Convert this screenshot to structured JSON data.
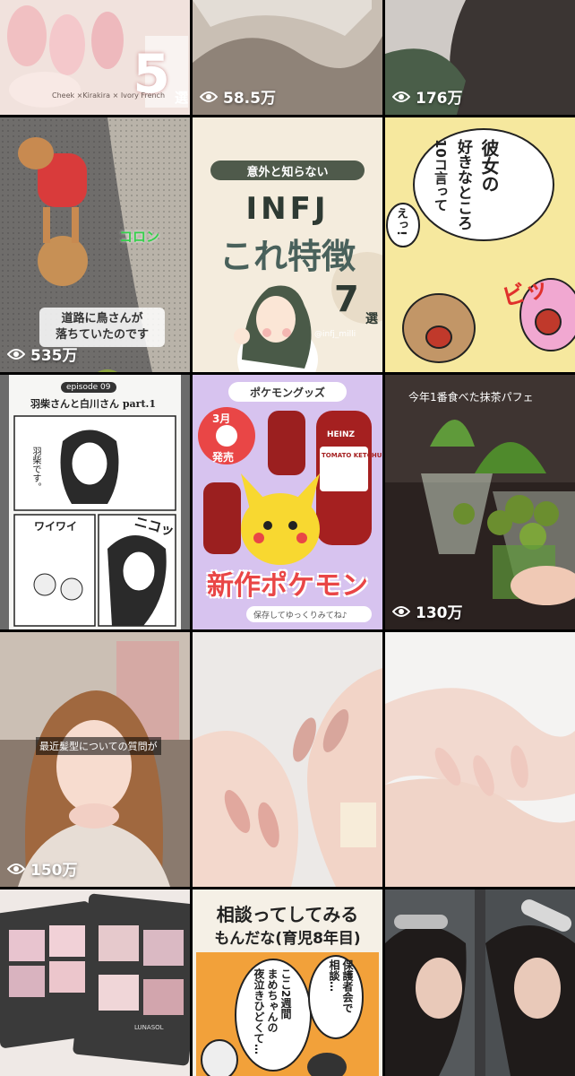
{
  "tiles": [
    {
      "views": "",
      "big_num": "5",
      "big_suffix": "選",
      "small_caption": "Cheek ×Kirakira × Ivory French"
    },
    {
      "views": "58.5万"
    },
    {
      "views": "176万"
    },
    {
      "views": "535万",
      "bubble": "道路に鳥さんが\n落ちていたのです",
      "tag": "コロン"
    },
    {
      "views": "",
      "banner": "意外と知らない",
      "line1": "INFJ",
      "line2": "これ特徴",
      "num": "7",
      "suffix": "選",
      "handle": "@infj_milli"
    },
    {
      "views": "",
      "speech_lines": [
        "彼女の",
        "好きなところ",
        "10コ言って"
      ],
      "small_bubble": "えっ!",
      "sfx": "ビッ"
    },
    {
      "views": "",
      "episode": "episode 09",
      "title": "羽柴さんと白川さん part.1",
      "bubble1": "羽柴です。",
      "bubble2": "ワイワイ",
      "sfx": "ニコッ"
    },
    {
      "views": "",
      "header": "ポケモングッズ",
      "date_month": "3月",
      "date_label": "発売",
      "brand": "HEINZ",
      "product": "TOMATO KETCHUP",
      "headline": "新作ポケモン",
      "save_bar": "保存してゆっくりみてね♪"
    },
    {
      "views": "130万",
      "overlay_text": "今年1番食べた抹茶パフェ"
    },
    {
      "views": "150万",
      "caption": "最近髪型についての質問が"
    },
    {
      "views": ""
    },
    {
      "views": ""
    },
    {
      "views": "",
      "brand": "LUNASOL"
    },
    {
      "views": "",
      "title1": "相談ってしてみる",
      "title2": "もんだな(育児8年目)",
      "bubble1": "ここ2週間\nまめちゃんの\n夜泣きひどくて…",
      "bubble2": "保護者会で\n相談…"
    },
    {
      "views": ""
    }
  ],
  "colors": {
    "accent_red": "#e94646",
    "pokemon_purple": "#d7c3ef",
    "matcha": "#5f9a3a",
    "infj_bg": "#f4ecdd"
  }
}
